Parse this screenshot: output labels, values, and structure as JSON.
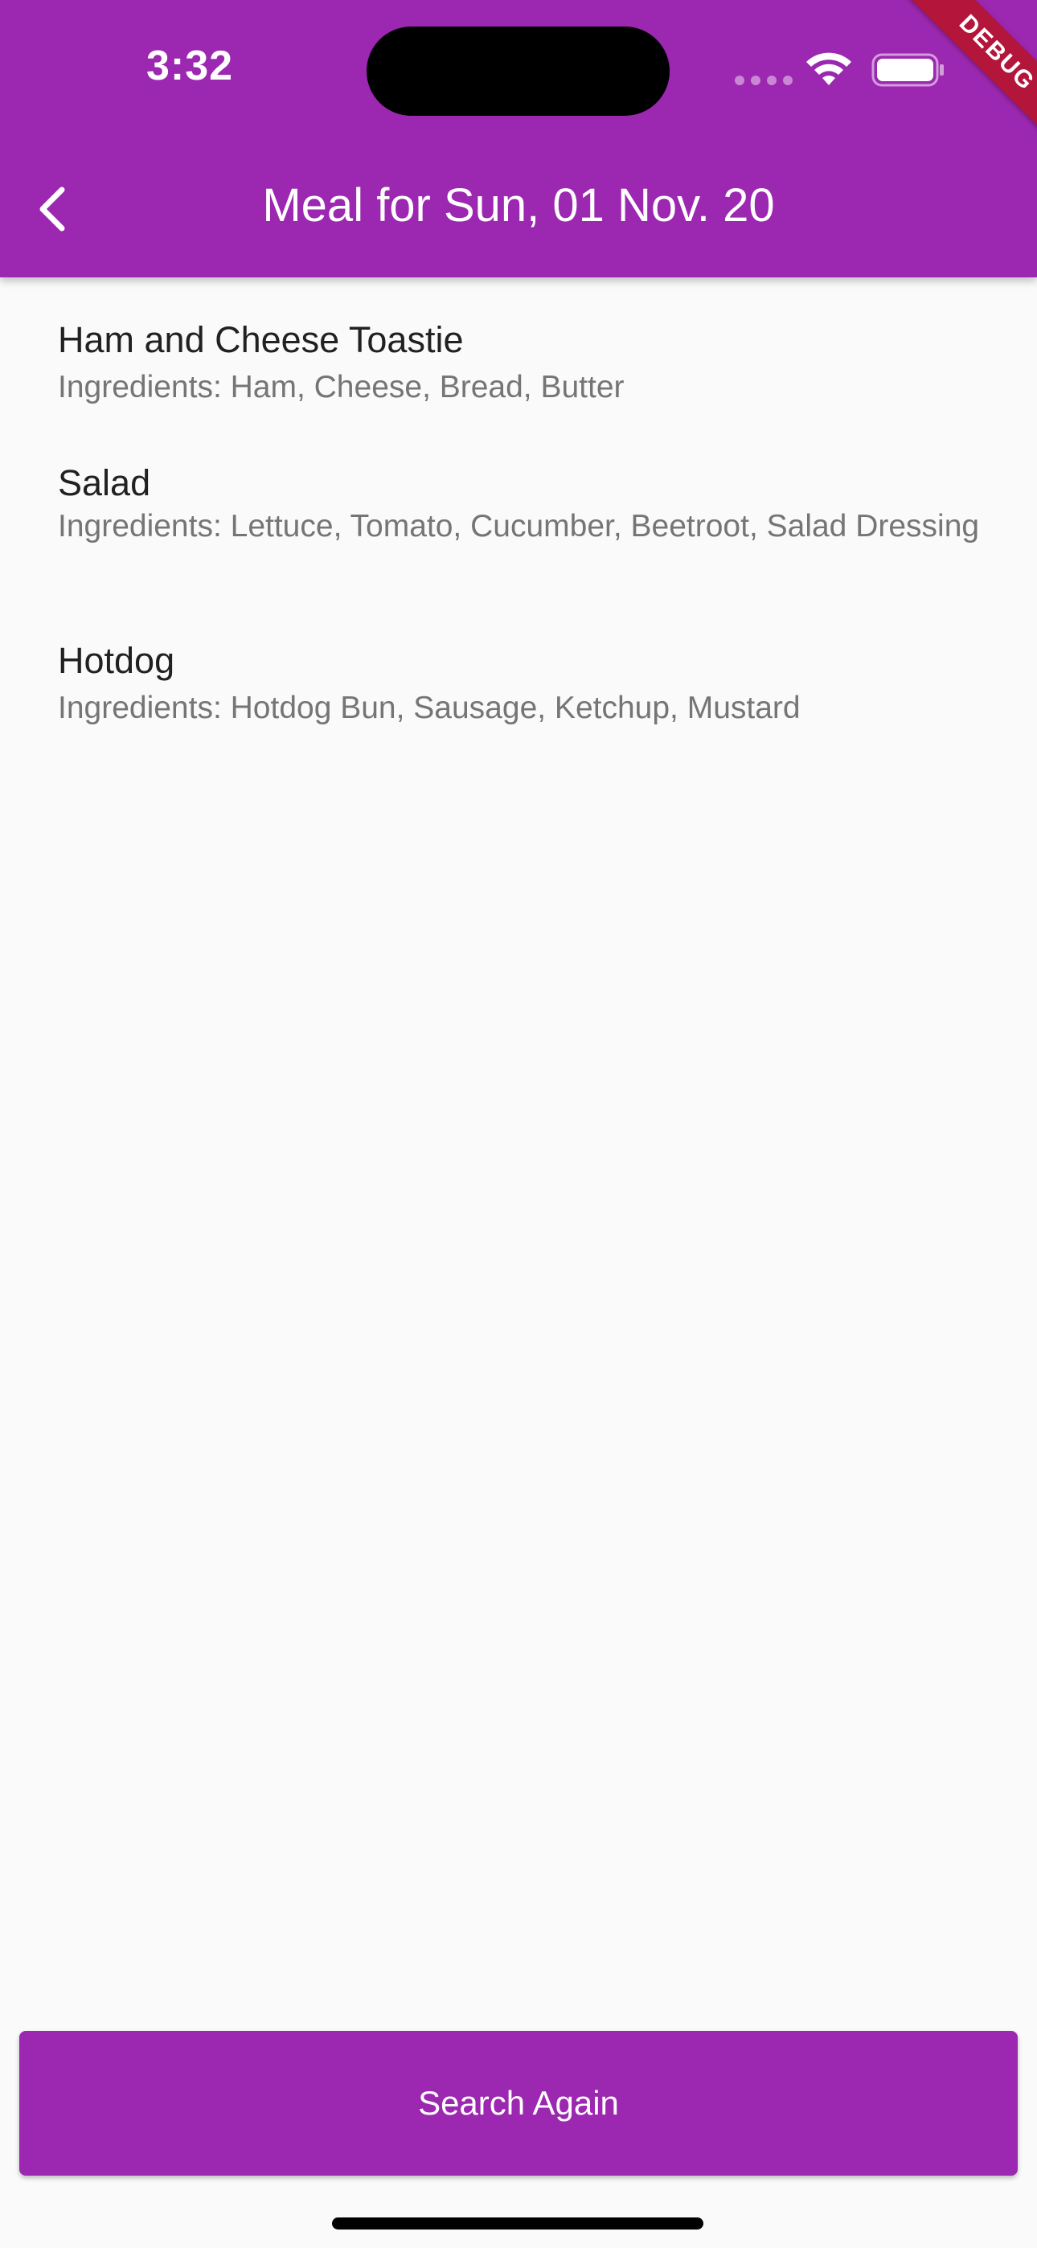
{
  "status_bar": {
    "time": "3:32"
  },
  "debug_banner": "DEBUG",
  "app_bar": {
    "title": "Meal for Sun, 01 Nov. 20",
    "back_icon": "chevron-left-icon"
  },
  "meals": [
    {
      "name": "Ham and Cheese Toastie",
      "ingredients": "Ingredients: Ham, Cheese, Bread, Butter"
    },
    {
      "name": "Salad",
      "ingredients": "Ingredients: Lettuce, Tomato, Cucumber, Beetroot, Salad Dressing"
    },
    {
      "name": "Hotdog",
      "ingredients": "Ingredients: Hotdog Bun, Sausage, Ketchup, Mustard"
    }
  ],
  "actions": {
    "search_again_label": "Search Again"
  },
  "colors": {
    "primary": "#9c27b0",
    "background": "#fafafa",
    "title_text": "#212121",
    "subtitle_text": "#757575",
    "debug_ribbon": "#b4153a"
  }
}
